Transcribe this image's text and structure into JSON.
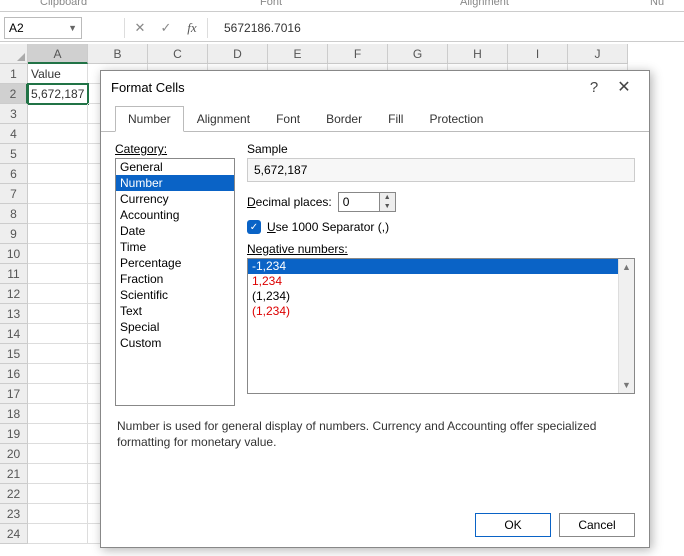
{
  "ribbon_groups": {
    "clipboard": "Clipboard",
    "font": "Font",
    "alignment": "Alignment",
    "number": "Nu"
  },
  "namebox": {
    "value": "A2"
  },
  "formula_bar": {
    "value": "5672186.7016"
  },
  "columns": [
    "A",
    "B",
    "C",
    "D",
    "E",
    "F",
    "G",
    "H",
    "I",
    "J"
  ],
  "active_col": "A",
  "rows": [
    "1",
    "2",
    "3",
    "4",
    "5",
    "6",
    "7",
    "8",
    "9",
    "10",
    "11",
    "12",
    "13",
    "14",
    "15",
    "16",
    "17",
    "18",
    "19",
    "20",
    "21",
    "22",
    "23",
    "24"
  ],
  "active_row": "2",
  "cells": {
    "A1": "Value",
    "A2": "5,672,187"
  },
  "dialog": {
    "title": "Format Cells",
    "tabs": [
      "Number",
      "Alignment",
      "Font",
      "Border",
      "Fill",
      "Protection"
    ],
    "active_tab": "Number",
    "category_label": "Category:",
    "categories": [
      "General",
      "Number",
      "Currency",
      "Accounting",
      "Date",
      "Time",
      "Percentage",
      "Fraction",
      "Scientific",
      "Text",
      "Special",
      "Custom"
    ],
    "selected_category": "Number",
    "sample_label": "Sample",
    "sample_value": "5,672,187",
    "decimal_label_u": "D",
    "decimal_label_rest": "ecimal places:",
    "decimal_value": "0",
    "separator_label_u": "U",
    "separator_label_rest": "se 1000 Separator (,)",
    "negative_label_u": "N",
    "negative_label_rest": "egative numbers:",
    "negatives": [
      {
        "text": "-1,234",
        "color": "white",
        "selected": true
      },
      {
        "text": "1,234",
        "color": "red"
      },
      {
        "text": "(1,234)",
        "color": "black"
      },
      {
        "text": "(1,234)",
        "color": "red"
      }
    ],
    "description": "Number is used for general display of numbers.  Currency and Accounting offer specialized formatting for monetary value.",
    "ok": "OK",
    "cancel": "Cancel"
  }
}
